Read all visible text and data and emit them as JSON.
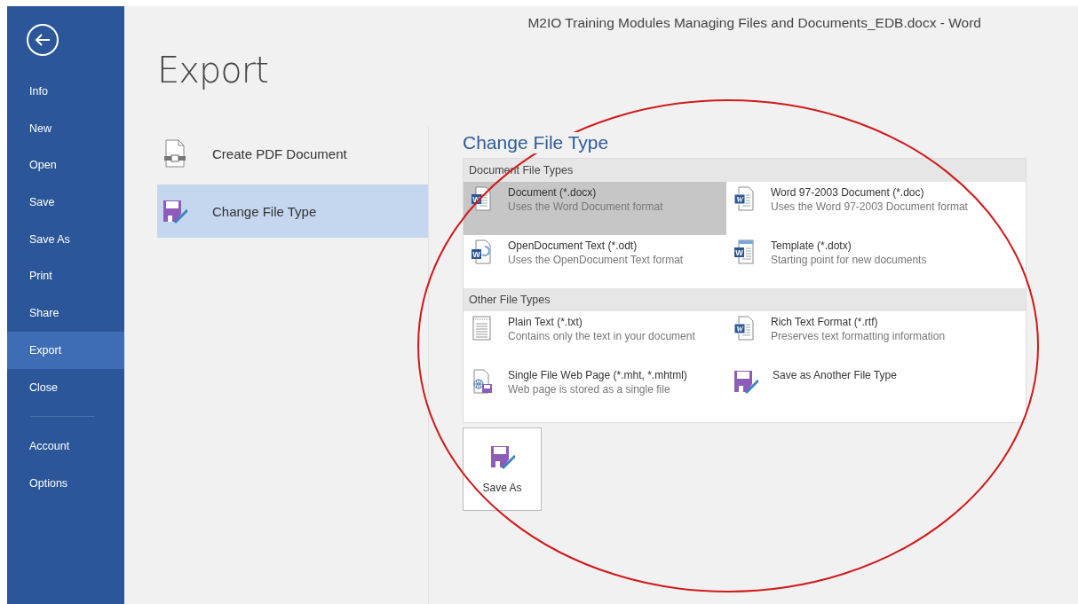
{
  "window": {
    "title": "M2IO Training Modules Managing Files and Documents_EDB.docx - Word"
  },
  "sidebar": {
    "groups": [
      [
        {
          "label": "Info",
          "selected": false
        },
        {
          "label": "New",
          "selected": false
        },
        {
          "label": "Open",
          "selected": false
        },
        {
          "label": "Save",
          "selected": false
        },
        {
          "label": "Save As",
          "selected": false
        },
        {
          "label": "Print",
          "selected": false
        },
        {
          "label": "Share",
          "selected": false
        },
        {
          "label": "Export",
          "selected": true
        },
        {
          "label": "Close",
          "selected": false
        }
      ],
      [
        {
          "label": "Account",
          "selected": false
        },
        {
          "label": "Options",
          "selected": false
        }
      ]
    ]
  },
  "page_title": "Export",
  "export_options": [
    {
      "kind": "pdf",
      "label": "Create PDF Document",
      "selected": false
    },
    {
      "kind": "floppy",
      "label": "Change File Type",
      "selected": true
    }
  ],
  "change_file_type": {
    "heading": "Change File Type",
    "sections": [
      {
        "title": "Document File Types",
        "items": [
          {
            "kind": "word",
            "icon_letter": "W",
            "name": "Document (*.docx)",
            "description": "Uses the Word Document format",
            "selected": true
          },
          {
            "kind": "word97",
            "icon_letter": "W",
            "name": "Word 97-2003 Document (*.doc)",
            "description": "Uses the Word 97-2003 Document format",
            "selected": false
          },
          {
            "kind": "odt",
            "icon_letter": "W",
            "name": "OpenDocument Text (*.odt)",
            "description": "Uses the OpenDocument Text format",
            "selected": false
          },
          {
            "kind": "template",
            "icon_letter": "W",
            "name": "Template (*.dotx)",
            "description": "Starting point for new documents",
            "selected": false
          }
        ]
      },
      {
        "title": "Other File Types",
        "items": [
          {
            "kind": "text",
            "name": "Plain Text (*.txt)",
            "description": "Contains only the text in your document",
            "selected": false
          },
          {
            "kind": "word97",
            "icon_letter": "W",
            "name": "Rich Text Format (*.rtf)",
            "description": "Preserves text formatting information",
            "selected": false
          },
          {
            "kind": "web",
            "name": "Single File Web Page (*.mht, *.mhtml)",
            "description": "Web page is stored as a single file",
            "selected": false
          },
          {
            "kind": "floppy",
            "name": "Save as Another File Type",
            "selected": false
          }
        ]
      }
    ]
  },
  "save_as_button": {
    "label": "Save As"
  },
  "annotations": [
    {
      "kind": "ellipse"
    }
  ]
}
